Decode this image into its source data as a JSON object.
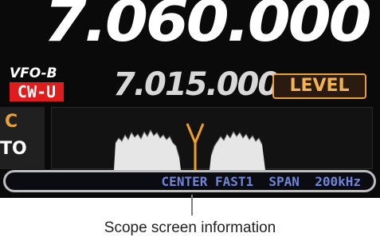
{
  "display": {
    "main_frequency": "7.060.000",
    "vfo_label": "VFO-B",
    "mode": "CW-U",
    "sub_frequency": "7.015.000",
    "level_button": "LEVEL",
    "side_top": "C",
    "side_bottom": "TO"
  },
  "scope": {
    "info": "CENTER FAST1  SPAN  200kHz",
    "marker_color": "#f0a020",
    "trace_color": "#e6e6e6"
  },
  "caption": "Scope screen information",
  "colors": {
    "background": "#0a0a0a",
    "mode_badge": "#e01c1c",
    "level_accent": "#e8a23a",
    "info_text": "#6f86d9"
  }
}
